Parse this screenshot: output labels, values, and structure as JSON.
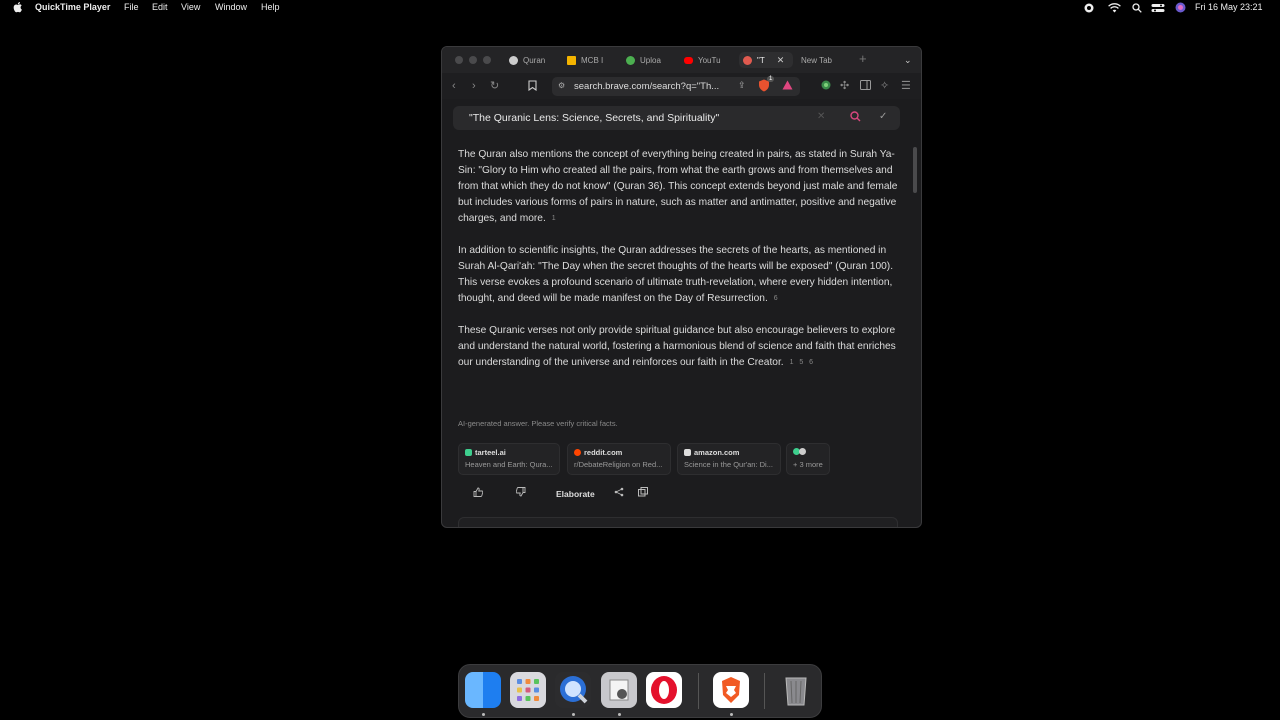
{
  "menubar": {
    "app_name": "QuickTime Player",
    "items": [
      "File",
      "Edit",
      "View",
      "Window",
      "Help"
    ],
    "datetime": "Fri 16 May  23:21"
  },
  "browser": {
    "tabs": [
      {
        "label": "Quran",
        "icon": "chatgpt-icon",
        "color": "#cccccc"
      },
      {
        "label": "MCB I",
        "icon": "google-drive-icon",
        "color": "#f4b400"
      },
      {
        "label": "Uploa",
        "icon": "play-icon",
        "color": "#4caf50"
      },
      {
        "label": "YouTu",
        "icon": "youtube-icon",
        "color": "#ff0000"
      },
      {
        "label": "\"T",
        "icon": "brave-search-icon",
        "color": "#e05a4f"
      },
      {
        "label": "New Tab",
        "icon": "",
        "color": ""
      }
    ],
    "address": "search.brave.com/search?q=\"Th...",
    "shield_badge": "1"
  },
  "search": {
    "query": "\"The Quranic Lens: Science, Secrets, and Spirituality\""
  },
  "answer": {
    "p1": "The Quran also mentions the concept of everything being created in pairs, as stated in Surah Ya-Sin: \"Glory to Him who created all the pairs, from what the earth grows and from themselves and from that which they do not know\" (Quran 36). This concept extends beyond just male and female but includes various forms of pairs in nature, such as matter and antimatter, positive and negative charges, and more.",
    "p1_cite": "1",
    "p2": "In addition to scientific insights, the Quran addresses the secrets of the hearts, as mentioned in Surah Al-Qari'ah: \"The Day when the secret thoughts of the hearts will be exposed\" (Quran 100). This verse evokes a profound scenario of ultimate truth-revelation, where every hidden intention, thought, and deed will be made manifest on the Day of Resurrection.",
    "p2_cite": "6",
    "p3": "These Quranic verses not only provide spiritual guidance but also encourage believers to explore and understand the natural world, fostering a harmonious blend of science and faith that enriches our understanding of the universe and reinforces our faith in the Creator.",
    "p3_cite": "1   5   6",
    "ai_note": "AI-generated answer. Please verify critical facts."
  },
  "sources": [
    {
      "domain": "tarteel.ai",
      "title": "Heaven and Earth: Qura...",
      "color": "#3ecf8e"
    },
    {
      "domain": "reddit.com",
      "title": "r/DebateReligion on Red...",
      "color": "#ff4500"
    },
    {
      "domain": "amazon.com",
      "title": "Science in the Qur'an: Di...",
      "color": "#dddddd"
    },
    {
      "domain": "",
      "title": "+ 3 more",
      "color": "#3ecf8e"
    }
  ],
  "actions": {
    "elaborate": "Elaborate"
  },
  "dock": {
    "apps": [
      "finder-icon",
      "launchpad-icon",
      "quicktime-icon",
      "preview-icon",
      "opera-icon",
      "brave-icon",
      "trash-icon"
    ]
  }
}
